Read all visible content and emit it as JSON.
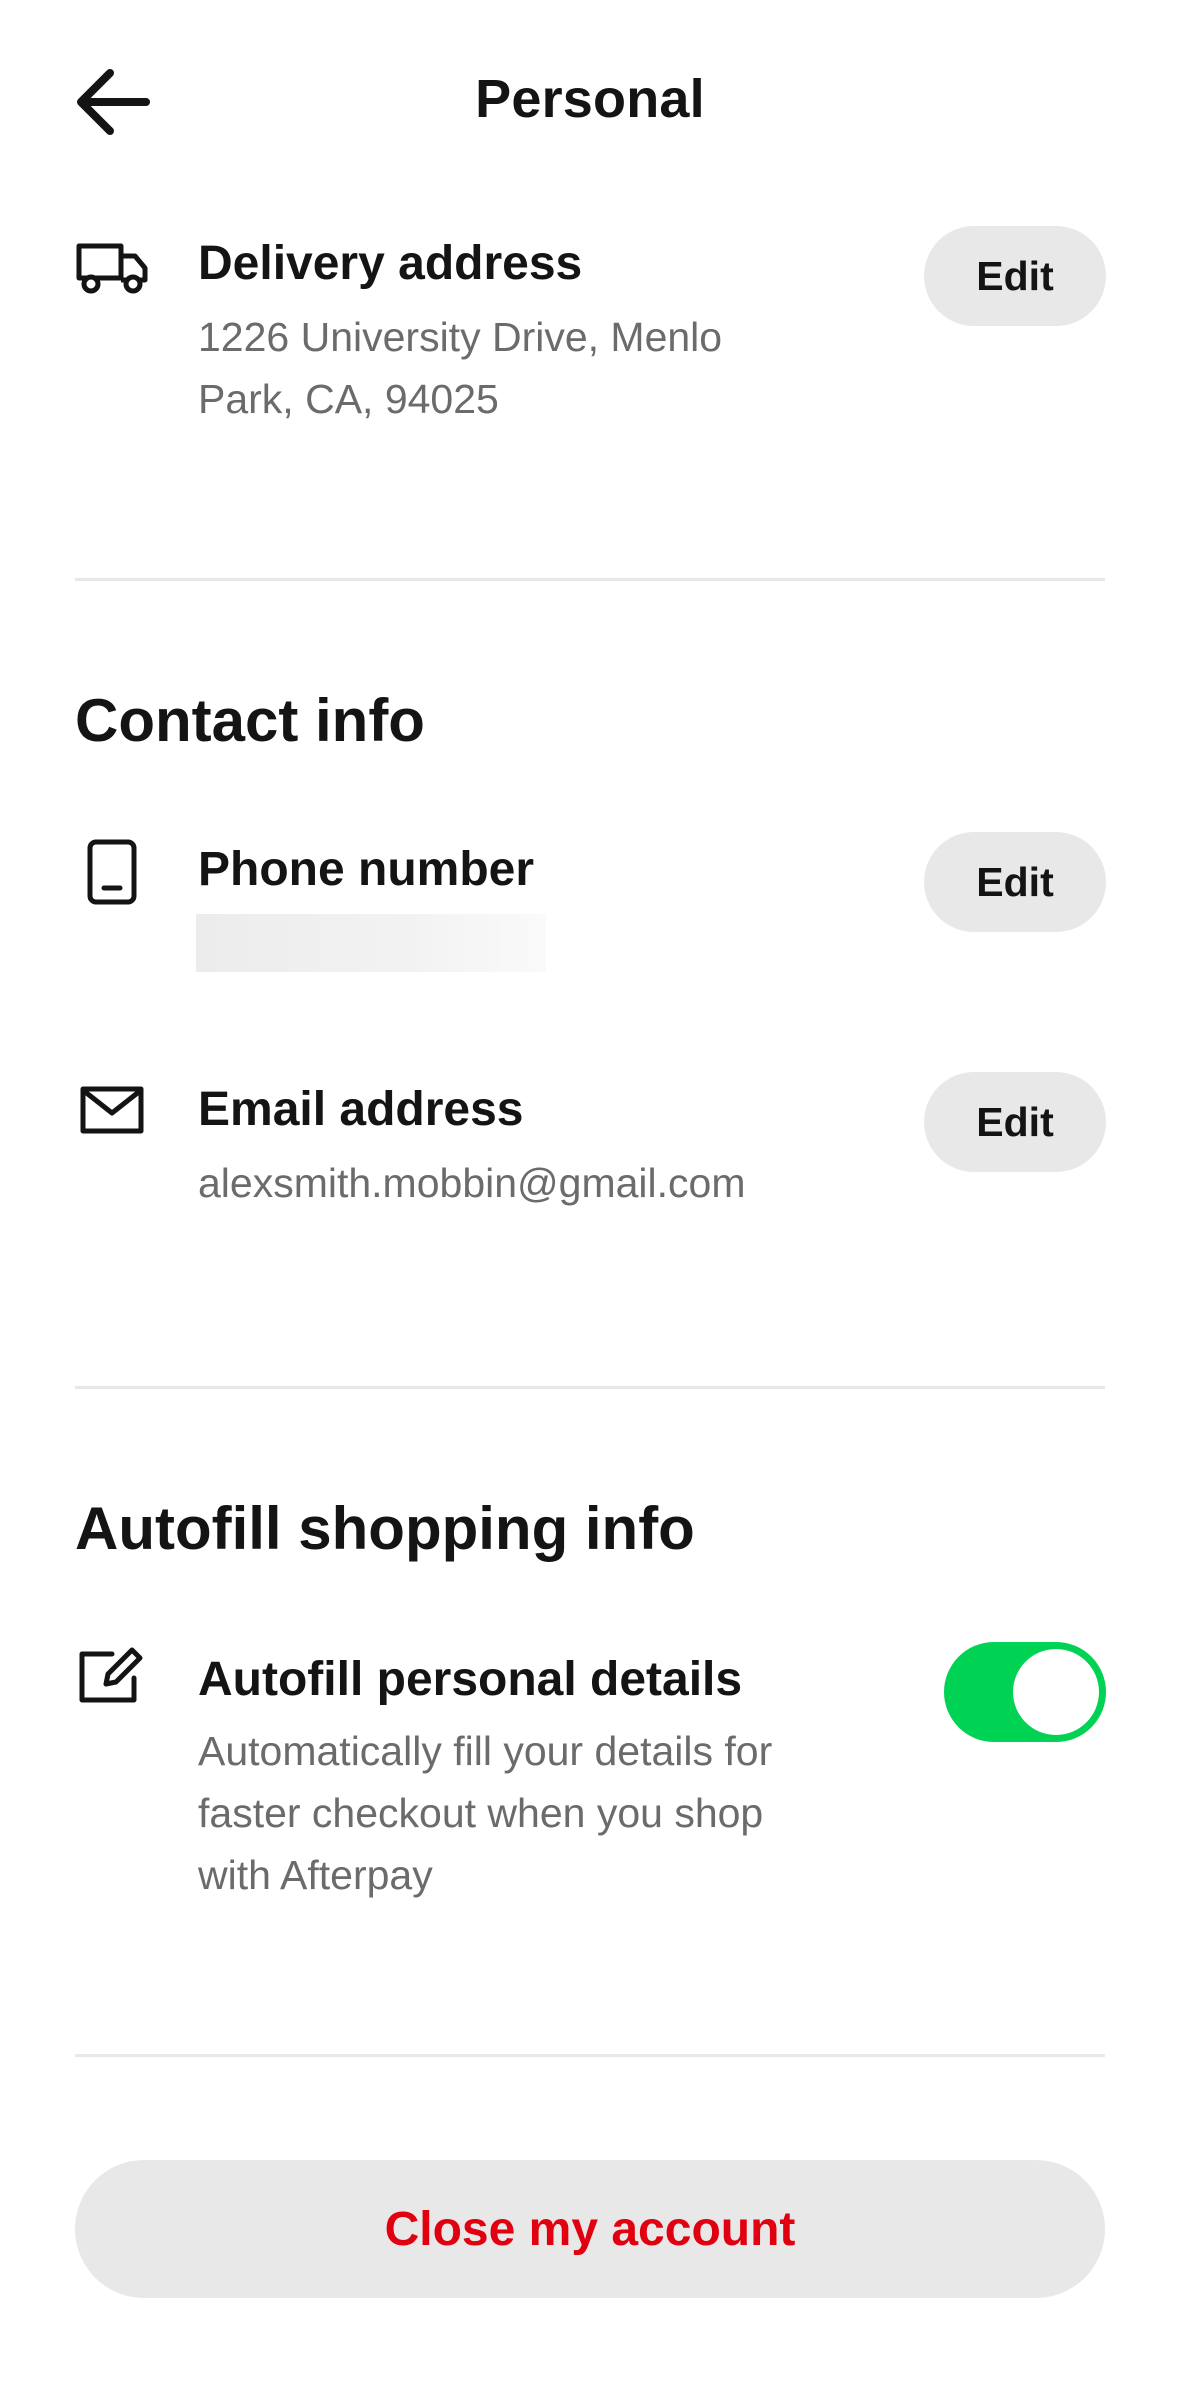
{
  "header": {
    "title": "Personal",
    "back_icon": "arrow-left-icon"
  },
  "delivery": {
    "icon": "truck-icon",
    "title": "Delivery address",
    "address_line1": "1226 University Drive, Menlo",
    "address_line2": "Park, CA, 94025",
    "edit_label": "Edit"
  },
  "contact": {
    "heading": "Contact info",
    "phone": {
      "icon": "phone-icon",
      "title": "Phone number",
      "value": "",
      "edit_label": "Edit"
    },
    "email": {
      "icon": "mail-icon",
      "title": "Email address",
      "value": "alexsmith.mobbin@gmail.com",
      "edit_label": "Edit"
    }
  },
  "autofill": {
    "heading": "Autofill shopping info",
    "item": {
      "icon": "edit-square-icon",
      "title": "Autofill personal details",
      "desc_line1": "Automatically fill your details for",
      "desc_line2": "faster checkout when you shop",
      "desc_line3": "with Afterpay",
      "enabled": true
    }
  },
  "close_account": {
    "label": "Close my account"
  },
  "colors": {
    "accent_green": "#00d254",
    "danger_red": "#e0000f",
    "button_gray": "#e8e8e8",
    "text_secondary": "#6b6b6b"
  }
}
